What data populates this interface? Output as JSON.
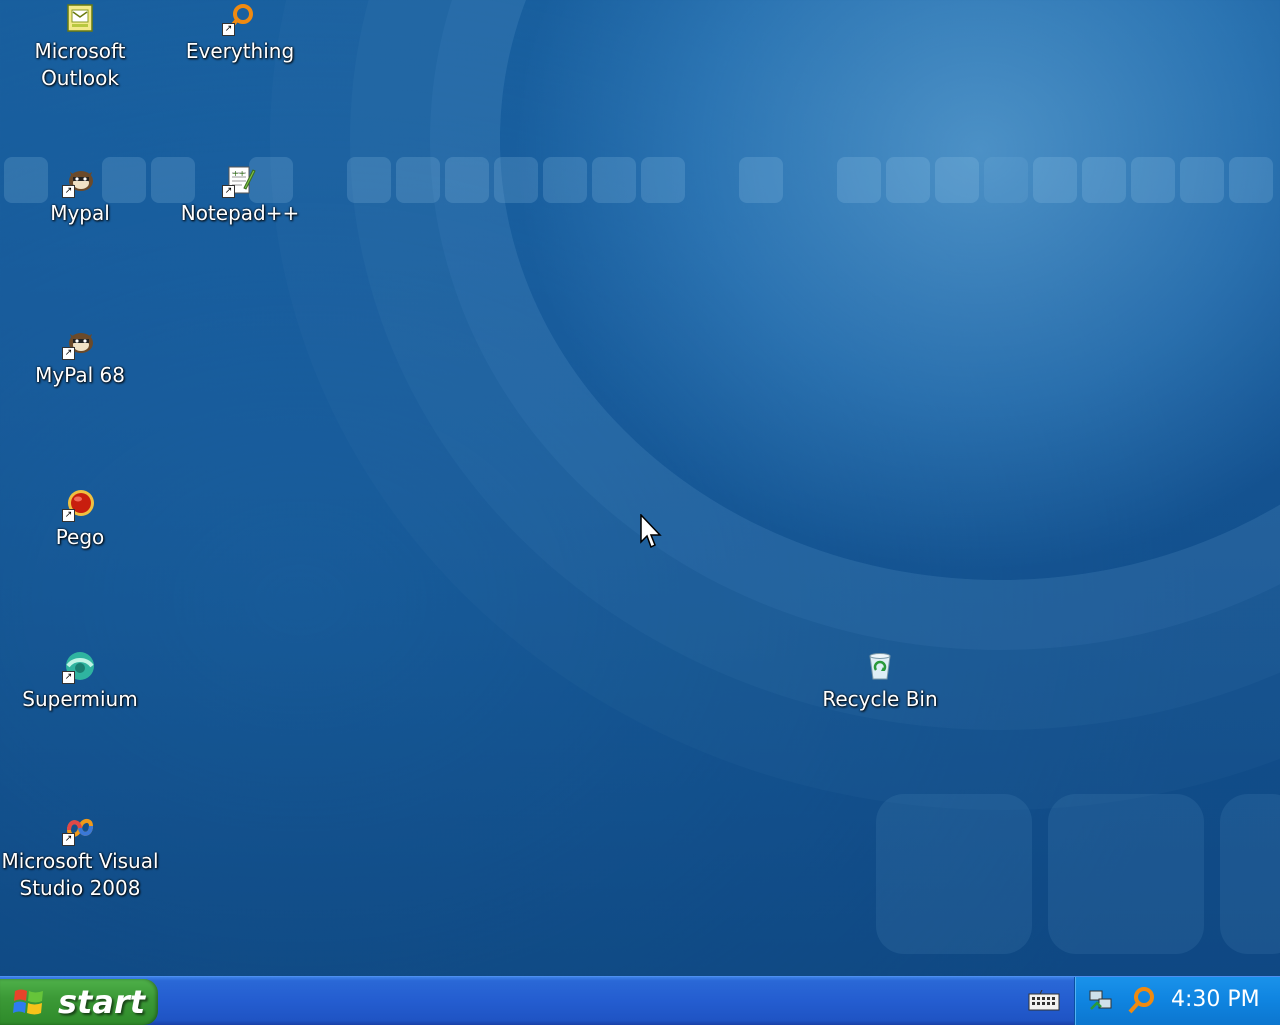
{
  "desktop": {
    "icons": [
      {
        "label": "Microsoft\nOutlook",
        "icon": "outlook-icon"
      },
      {
        "label": "Everything",
        "icon": "everything-search-icon"
      },
      {
        "label": "Mypal",
        "icon": "mypal-icon"
      },
      {
        "label": "Notepad++",
        "icon": "notepadpp-icon"
      },
      {
        "label": "MyPal 68",
        "icon": "mypal68-icon"
      },
      {
        "label": "Pego",
        "icon": "pego-icon"
      },
      {
        "label": "Supermium",
        "icon": "supermium-icon"
      },
      {
        "label": "Recycle Bin",
        "icon": "recycle-bin-icon"
      },
      {
        "label": "Microsoft Visual\nStudio 2008",
        "icon": "visual-studio-icon"
      }
    ]
  },
  "taskbar": {
    "start_label": "start",
    "clock": "4:30 PM"
  },
  "colors": {
    "taskbar": "#245dd0",
    "start_button": "#3c9a37",
    "tray": "#0f84e0"
  }
}
